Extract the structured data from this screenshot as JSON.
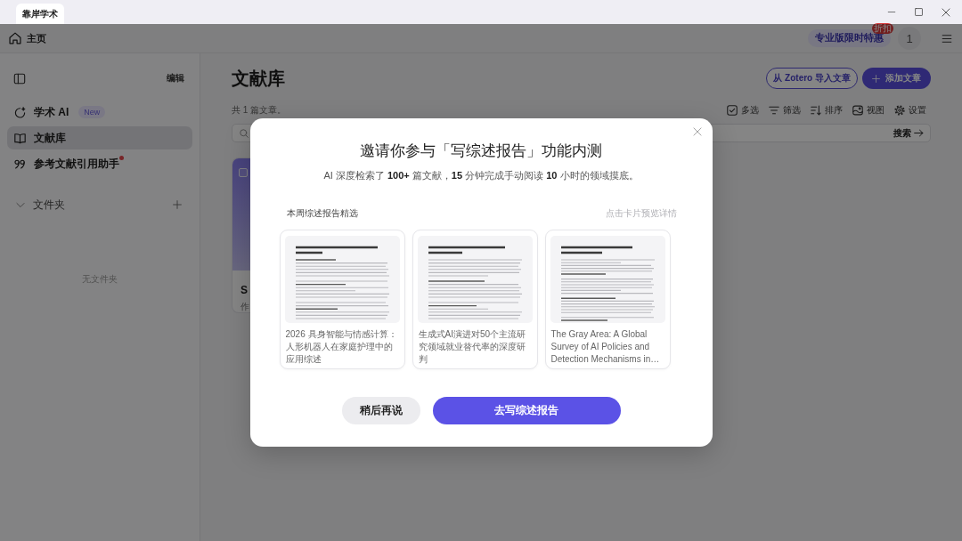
{
  "window": {
    "tab_title": "靠岸学术"
  },
  "header": {
    "home": "主页",
    "promo": {
      "label": "专业版限时特惠",
      "badge": "折扣"
    },
    "avatar": "1"
  },
  "sidebar": {
    "edit": "编辑",
    "items": [
      {
        "kind": "ai",
        "label": "学术 AI",
        "badge": "New",
        "selected": false,
        "notification": false
      },
      {
        "kind": "library",
        "label": "文献库",
        "selected": true,
        "notification": false
      },
      {
        "kind": "citation",
        "label": "参考文献引用助手",
        "selected": false,
        "notification": true
      }
    ],
    "folders": {
      "label": "文件夹",
      "expanded": true,
      "empty_text": "无文件夹"
    }
  },
  "library": {
    "title": "文献库",
    "count": "共 1 篇文章。",
    "actions": [
      {
        "kind": "import",
        "label": "从 Zotero 导入文章"
      },
      {
        "kind": "add",
        "label": "添加文章"
      }
    ],
    "tools": [
      {
        "kind": "select",
        "label": "多选"
      },
      {
        "kind": "filter",
        "label": "筛选"
      },
      {
        "kind": "sort",
        "label": "排序"
      },
      {
        "kind": "view",
        "label": "视图"
      },
      {
        "kind": "settings",
        "label": "设置"
      }
    ],
    "search": {
      "button": "搜索"
    },
    "articles": [
      {
        "title": "S",
        "meta": "作",
        "checked": false
      }
    ]
  },
  "dialog": {
    "title": "邀请你参与「写综述报告」功能内测",
    "subtitle": "AI 深度检索了 **100+** 篇文献，**15** 分钟完成手动阅读 **10** 小时的领域摸底。",
    "section_label": "本周综述报告精选",
    "hint": "点击卡片预览详情",
    "reports": [
      {
        "title": "2026 具身智能与情感计算：人形机器人在家庭护理中的应用综述"
      },
      {
        "title": "生成式AI演进对50个主流研究领域就业替代率的深度研判"
      },
      {
        "title": "The Gray Area: A Global Survey of AI Policies and Detection Mechanisms in…"
      }
    ],
    "buttons": [
      {
        "kind": "secondary",
        "label": "稍后再说"
      },
      {
        "kind": "primary",
        "label": "去写综述报告"
      }
    ]
  }
}
